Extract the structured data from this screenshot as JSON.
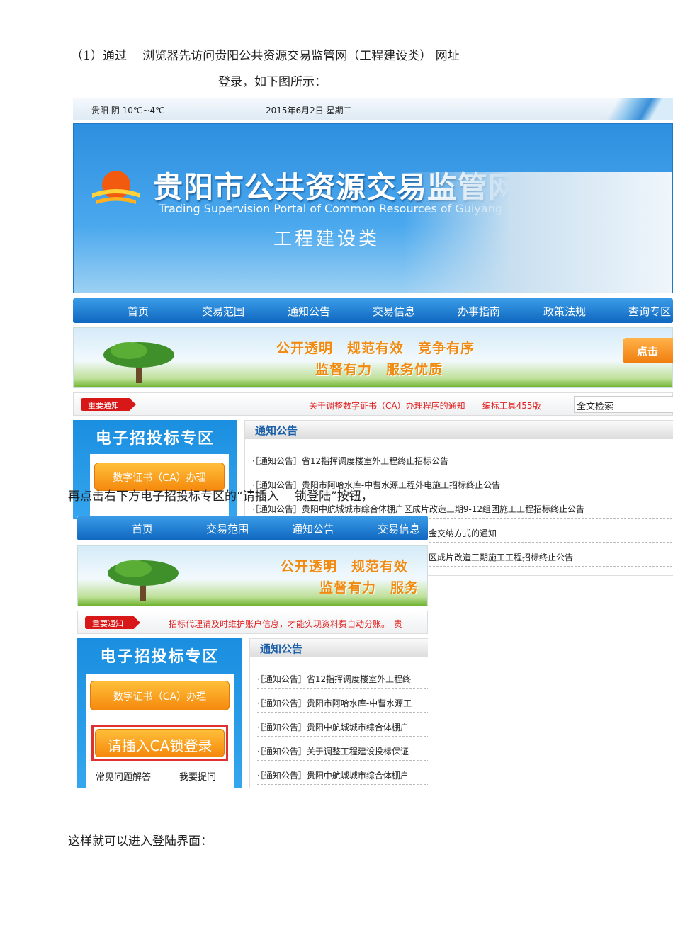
{
  "doc": {
    "para1_line1": "（1）通过　 浏览器先访问贵阳公共资源交易监管网（工程建设类） 网址",
    "para1_line2": "登录，如下图所示：",
    "para2": "再点击右下方电子招投标专区的“请插入　 锁登陆”按钮，",
    "para3": "这样就可以进入登陆界面："
  },
  "shot1": {
    "weather": "贵阳 阴 10℃~4℃",
    "date": "2015年6月2日 星期二",
    "banner_title": "贵阳市公共资源交易监管网",
    "banner_subtitle": "Trading Supervision Portal of Common Resources of Guiyang",
    "banner_category": "工程建设类",
    "nav": [
      "首页",
      "交易范围",
      "通知公告",
      "交易信息",
      "办事指南",
      "政策法规",
      "查询专区"
    ],
    "slogan_line1": "公开透明　规范有效　竞争有序",
    "slogan_line2": "监督有力　服务优质",
    "click_button": "点击",
    "notice_tag": "重要通知",
    "notice_text": "关于调整数字证书（CA）办理程序的通知　　编标工具455版",
    "search_placeholder": "全文检索",
    "panel_title": "电子招投标专区",
    "ca_button": "数字证书（CA）办理",
    "list_header": "通知公告",
    "items": [
      "·［通知公告］省12指挥调度楼室外工程终止招标公告",
      "·［通知公告］贵阳市阿哈水库-中曹水源工程外电施工招标终止公告",
      "·［通知公告］贵阳中航城城市综合体棚户区成片改造三期9-12组团施工工程招标终止公告",
      "金交纳方式的通知",
      "区成片改造三期施工工程招标终止公告"
    ]
  },
  "shot2": {
    "nav": [
      "首页",
      "交易范围",
      "通知公告",
      "交易信息"
    ],
    "slogan_line1": "公开透明　规范有效",
    "slogan_line2": "监督有力　服务",
    "notice_tag": "重要通知",
    "notice_text": "招标代理请及时维护账户信息，才能实现资料费自动分账。　贵",
    "panel_title": "电子招投标专区",
    "ca_button": "数字证书（CA）办理",
    "login_button": "请插入CA锁登录",
    "faq_link": "常见问题解答",
    "ask_link": "我要提问",
    "list_header": "通知公告",
    "items": [
      "·［通知公告］省12指挥调度楼室外工程终",
      "·［通知公告］贵阳市阿哈水库-中曹水源工",
      "·［通知公告］贵阳中航城城市综合体棚户",
      "·［通知公告］关于调整工程建设投标保证",
      "·［通知公告］贵阳中航城城市综合体棚户"
    ],
    "highlight_color": "#e03030"
  }
}
